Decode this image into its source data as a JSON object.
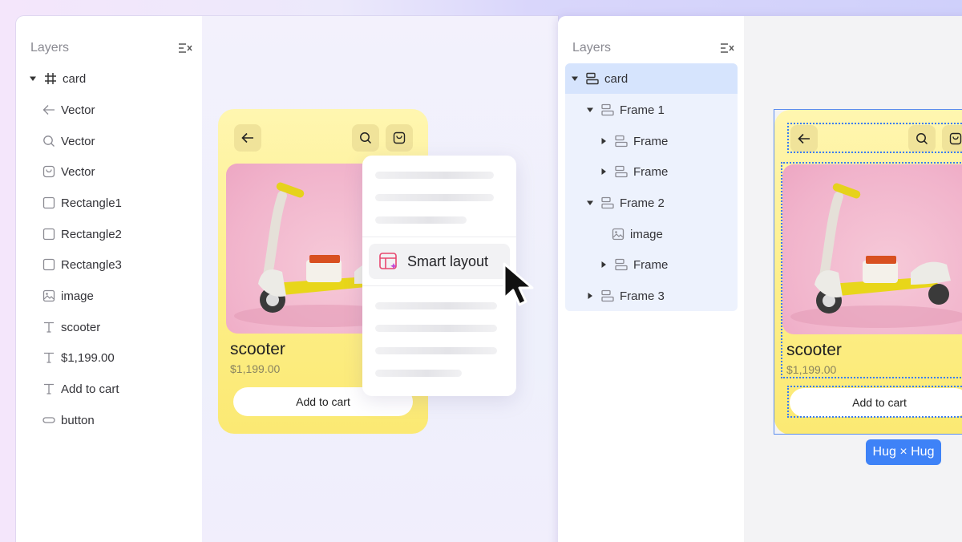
{
  "left_panel": {
    "title": "Layers",
    "root": "card",
    "items": [
      {
        "label": "Vector",
        "icon": "arrow-left-icon"
      },
      {
        "label": "Vector",
        "icon": "search-icon"
      },
      {
        "label": "Vector",
        "icon": "bag-icon"
      },
      {
        "label": "Rectangle1",
        "icon": "rectangle-icon"
      },
      {
        "label": "Rectangle2",
        "icon": "rectangle-icon"
      },
      {
        "label": "Rectangle3",
        "icon": "rectangle-icon"
      },
      {
        "label": "image",
        "icon": "image-icon"
      },
      {
        "label": "scooter",
        "icon": "text-icon"
      },
      {
        "label": "$1,199.00",
        "icon": "text-icon"
      },
      {
        "label": "Add to cart",
        "icon": "text-icon"
      },
      {
        "label": "button",
        "icon": "pill-icon"
      }
    ]
  },
  "product": {
    "name": "scooter",
    "price": "$1,199.00",
    "cta": "Add to cart"
  },
  "menu": {
    "highlighted": "Smart layout"
  },
  "right_panel": {
    "title": "Layers",
    "tree": [
      {
        "label": "card",
        "level": 0,
        "expanded": true,
        "selected": true
      },
      {
        "label": "Frame 1",
        "level": 1,
        "expanded": true
      },
      {
        "label": "Frame",
        "level": 2,
        "expanded": false
      },
      {
        "label": "Frame",
        "level": 2,
        "expanded": false
      },
      {
        "label": "Frame 2",
        "level": 1,
        "expanded": true
      },
      {
        "label": "image",
        "level": 2,
        "icon": "image-icon"
      },
      {
        "label": "Frame",
        "level": 2,
        "expanded": false
      },
      {
        "label": "Frame 3",
        "level": 1,
        "expanded": false
      }
    ]
  },
  "sizing_badge": "Hug × Hug",
  "colors": {
    "card_yellow": "#fdee86",
    "photo_pink": "#f1b3cb",
    "selection_blue": "#3e82f7",
    "tree_selected": "#d6e4fd",
    "smart_layout_accent": "#e8476f"
  }
}
